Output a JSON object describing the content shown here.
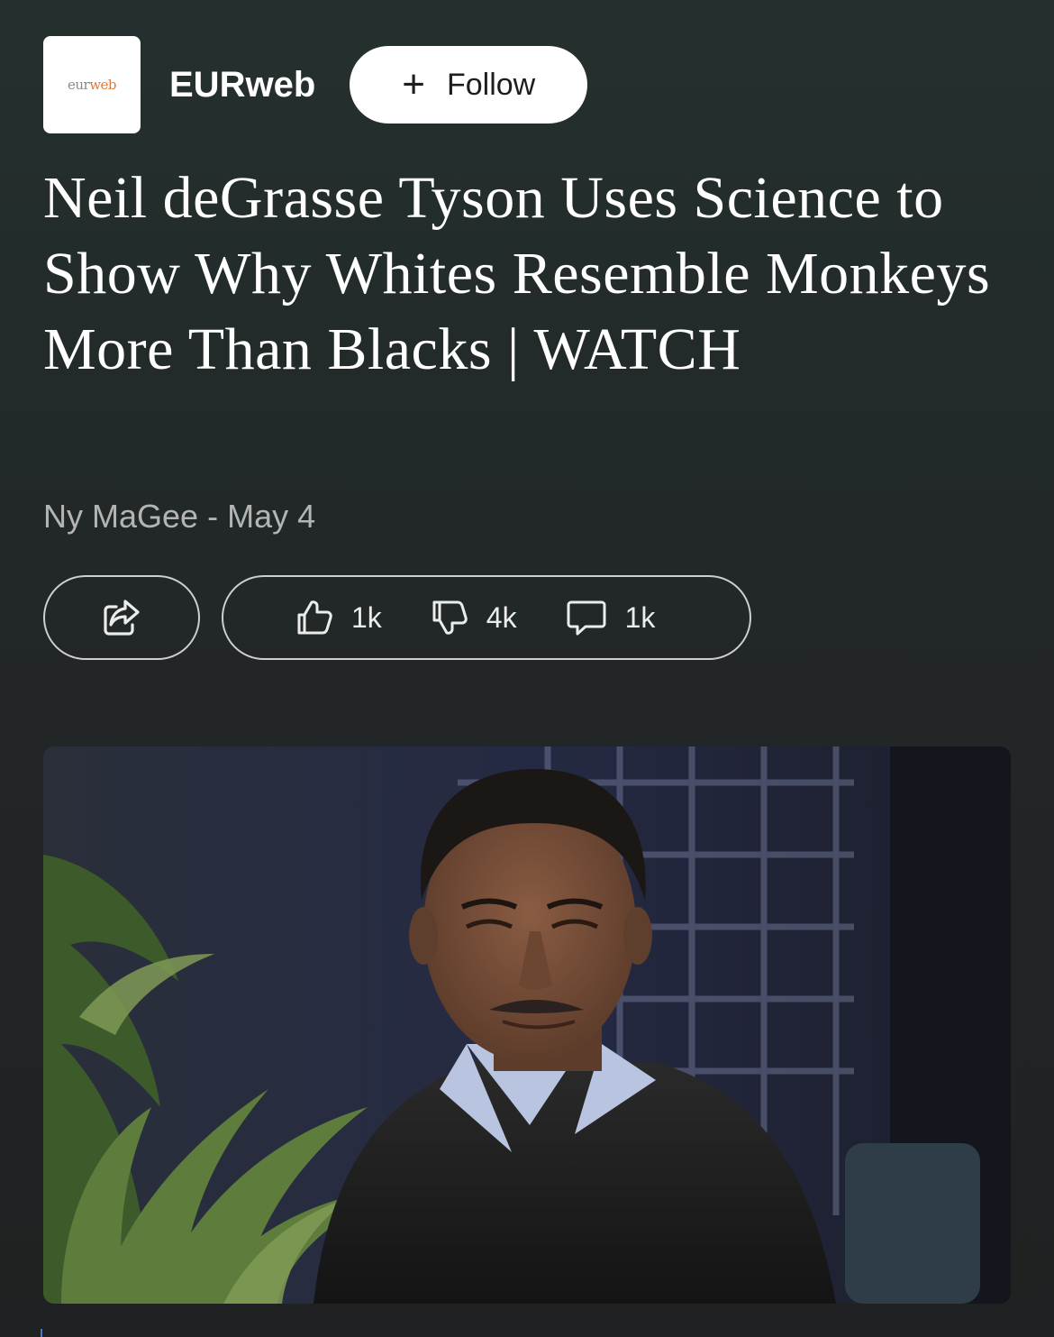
{
  "publisher": {
    "logo_text": "eurweb",
    "name": "EURweb",
    "follow_label": "Follow",
    "follow_icon": "plus-icon"
  },
  "article": {
    "headline": "Neil deGrasse Tyson Uses Science to Show Why Whites Resemble Monkeys More Than Blacks | WATCH",
    "author": "Ny MaGee",
    "separator": "-",
    "date": "May 4"
  },
  "actions": {
    "share_icon": "share-icon",
    "like": {
      "icon": "thumbs-up-icon",
      "count": "1k"
    },
    "dislike": {
      "icon": "thumbs-down-icon",
      "count": "4k"
    },
    "comments": {
      "icon": "comment-icon",
      "count": "1k"
    }
  },
  "colors": {
    "background_top": "#24302f",
    "background_bottom": "#202122",
    "pill_border": "#cfcfcf",
    "byline": "#b4b4b4"
  }
}
